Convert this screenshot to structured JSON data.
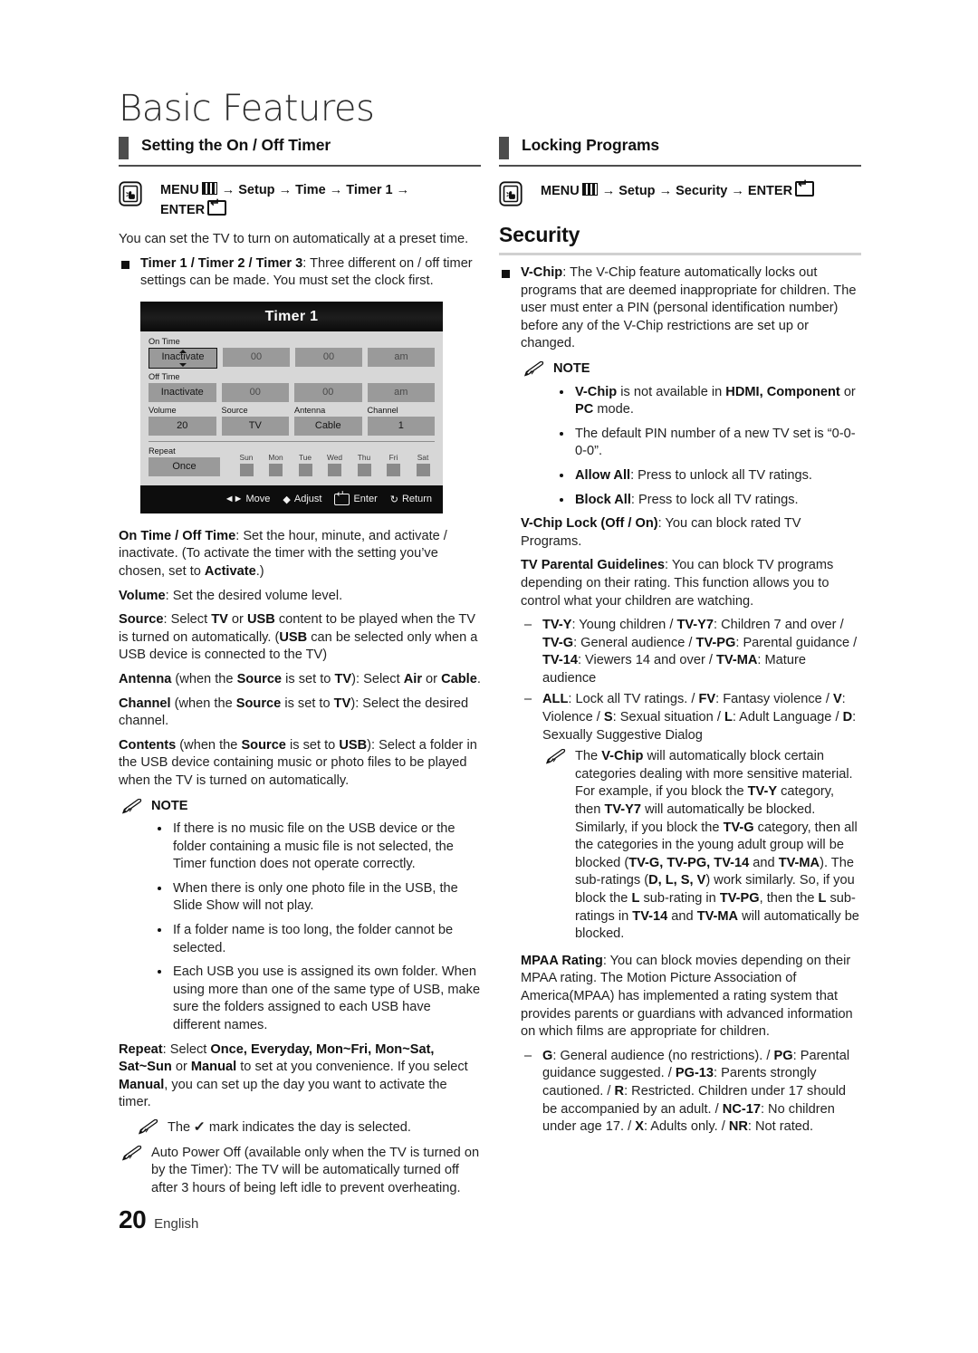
{
  "page": {
    "chapter_title": "Basic Features",
    "number": "20",
    "language": "English"
  },
  "left": {
    "section": {
      "label": "Setting the On / Off Timer"
    },
    "menu_path": {
      "menu": "MENU",
      "arrow1": "→",
      "setup": "Setup",
      "arrow2": "→",
      "time": "Time",
      "arrow3": "→",
      "timer": "Timer 1",
      "arrow4": "→",
      "enter": "ENTER"
    },
    "intro": "You can set the TV to turn on automatically at a preset time.",
    "timer_bullet_bold": "Timer 1 / Timer 2 / Timer 3",
    "timer_bullet_rest": ": Three different on / off timer settings can be made. You must set the clock first.",
    "osd": {
      "title": "Timer 1",
      "on_time_label": "On Time",
      "on_time": [
        "Inactivate",
        "00",
        "00",
        "am"
      ],
      "off_time_label": "Off Time",
      "off_time": [
        "Inactivate",
        "00",
        "00",
        "am"
      ],
      "labels_row": [
        "Volume",
        "Source",
        "Antenna",
        "Channel"
      ],
      "values_row": [
        "20",
        "TV",
        "Cable",
        "1"
      ],
      "repeat_label": "Repeat",
      "repeat_value": "Once",
      "days": [
        "Sun",
        "Mon",
        "Tue",
        "Wed",
        "Thu",
        "Fri",
        "Sat"
      ],
      "footer": [
        "Move",
        "Adjust",
        "Enter",
        "Return"
      ]
    },
    "paras": {
      "on_off_bold": "On Time / Off Time",
      "on_off_p1": ": Set the hour, minute, and activate / inactivate. (To activate the timer with the setting you’ve chosen, set to ",
      "on_off_activate": "Activate",
      "on_off_p2": ".)",
      "volume_bold": "Volume",
      "volume_rest": ": Set the desired volume level.",
      "source_bold": "Source",
      "source_a": ": Select ",
      "source_tv": "TV",
      "source_b": " or ",
      "source_usb": "USB",
      "source_c": " content to be played when the TV is turned on automatically. (",
      "source_usb2": "USB",
      "source_d": " can be selected only when a USB device is connected to the TV)",
      "antenna_bold": "Antenna",
      "antenna_a": " (when the ",
      "antenna_source": "Source",
      "antenna_b": " is set to ",
      "antenna_tv": "TV",
      "antenna_c": "): Select ",
      "antenna_air": "Air",
      "antenna_d": " or ",
      "antenna_cable": "Cable",
      "antenna_e": ".",
      "channel_bold": "Channel",
      "channel_a": " (when the ",
      "channel_source": "Source",
      "channel_b": " is set to ",
      "channel_tv": "TV",
      "channel_c": "): Select the desired channel.",
      "contents_bold": "Contents",
      "contents_a": " (when the ",
      "contents_source": "Source",
      "contents_b": " is set to ",
      "contents_usb": "USB",
      "contents_c": "): Select a folder in the USB device containing music or photo files to be played when the TV is turned on automatically."
    },
    "note_label": "NOTE",
    "notes": [
      "If there is no music file on the USB device or the folder containing a music file is not selected, the Timer function does not operate correctly.",
      "When there is only one photo file in the USB, the Slide Show will not play.",
      "If a folder name is too long, the folder cannot be selected.",
      "Each USB you use is assigned its own folder. When using more than one of the same type of USB, make sure the folders assigned to each USB have different names."
    ],
    "repeat": {
      "bold": "Repeat",
      "a": ": Select ",
      "opts1": "Once, Everyday, Mon~Fri, Mon~Sat, Sat~Sun",
      "b": " or ",
      "manual1": "Manual",
      "c": " to set at you convenience. If you select ",
      "manual2": "Manual",
      "d": ", you can set up the day you want to activate the timer."
    },
    "check_note_a": "The ",
    "check_note_b": " mark indicates the day is selected.",
    "auto_power_off": "Auto Power Off (available only when the TV is turned on by the Timer): The TV will be automatically turned off after 3 hours of being left idle to prevent overheating."
  },
  "right": {
    "section": {
      "label": "Locking Programs"
    },
    "menu_path": {
      "menu": "MENU",
      "arrow1": "→",
      "setup": "Setup",
      "arrow2": "→",
      "security": "Security",
      "arrow3": "→",
      "enter": "ENTER"
    },
    "heading": "Security",
    "vchip_bold": "V-Chip",
    "vchip_rest": ": The V-Chip feature automatically locks out programs that are deemed inappropriate for children. The user must enter a PIN (personal identification number) before any of the V-Chip restrictions are set up or changed.",
    "note_label": "NOTE",
    "notes": {
      "n1_a": "V-Chip",
      "n1_b": " is not available in ",
      "n1_c": "HDMI, Component",
      "n1_d": " or ",
      "n1_e": "PC",
      "n1_f": " mode.",
      "n2": "The default PIN number of a new TV set is “0-0-0-0”.",
      "n3_bold": "Allow All",
      "n3_rest": ": Press to unlock all TV ratings.",
      "n4_bold": "Block All",
      "n4_rest": ": Press to lock all TV ratings."
    },
    "vchip_lock_bold": "V-Chip Lock (Off / On)",
    "vchip_lock_rest": ": You can block rated TV Programs.",
    "tv_parental_bold": "TV Parental Guidelines",
    "tv_parental_rest": ": You can block TV programs depending on their rating. This function allows you to control what your children are watching.",
    "ratings_dash1": [
      {
        "b": "TV-Y",
        "t": ": Young children / "
      },
      {
        "b": "TV-Y7",
        "t": ": Children 7 and over / "
      },
      {
        "b": "TV-G",
        "t": ": General audience / "
      },
      {
        "b": "TV-PG",
        "t": ": Parental guidance / "
      },
      {
        "b": "TV-14",
        "t": ": Viewers 14 and over / "
      },
      {
        "b": "TV-MA",
        "t": ": Mature audience"
      }
    ],
    "ratings_dash2": [
      {
        "b": "ALL",
        "t": ": Lock all TV ratings. / "
      },
      {
        "b": "FV",
        "t": ": Fantasy violence / "
      },
      {
        "b": "V",
        "t": ": Violence / "
      },
      {
        "b": "S",
        "t": ": Sexual situation / "
      },
      {
        "b": "L",
        "t": ": Adult Language / "
      },
      {
        "b": "D",
        "t": ": Sexually Suggestive Dialog"
      }
    ],
    "vchip_note": {
      "a": "The ",
      "b1": "V-Chip",
      "c": " will automatically block certain categories dealing with more sensitive material. For example, if you block the ",
      "b2": "TV-Y",
      "d": " category, then ",
      "b3": "TV-Y7",
      "e": " will automatically be blocked. Similarly, if you block the ",
      "b4": "TV-G",
      "f": " category, then all the categories in the young adult group will be blocked (",
      "b5": "TV-G, TV-PG, TV-14",
      "g": " and ",
      "b6": "TV-MA",
      "h": "). The sub-ratings (",
      "b7": "D, L, S, V",
      "i": ") work similarly. So, if you block the ",
      "b8": "L",
      "j": " sub-rating in ",
      "b9": "TV-PG",
      "k": ", then the ",
      "b10": "L",
      "l": " sub-ratings in ",
      "b11": "TV-14",
      "m": " and ",
      "b12": "TV-MA",
      "n": " will automatically be blocked."
    },
    "mpaa_bold": "MPAA Rating",
    "mpaa_rest": ": You can block movies depending on their MPAA rating. The Motion Picture Association of America(MPAA) has implemented a rating system that provides parents or guardians with advanced information on which films are appropriate for children.",
    "mpaa_dash": [
      {
        "b": "G",
        "t": ": General audience (no restrictions). / "
      },
      {
        "b": "PG",
        "t": ": Parental guidance suggested. / "
      },
      {
        "b": "PG-13",
        "t": ": Parents strongly cautioned. / "
      },
      {
        "b": "R",
        "t": ": Restricted. Children under 17 should be accompanied by an adult. / "
      },
      {
        "b": "NC-17",
        "t": ": No children under age 17. / "
      },
      {
        "b": "X",
        "t": ": Adults only. / "
      },
      {
        "b": "NR",
        "t": ": Not rated."
      }
    ]
  }
}
